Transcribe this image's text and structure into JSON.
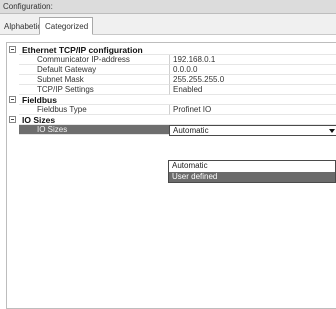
{
  "window": {
    "title": "Configuration:"
  },
  "tabs": [
    {
      "label": "Alphabetic",
      "active": false
    },
    {
      "label": "Categorized",
      "active": true
    }
  ],
  "grid": {
    "categories": [
      {
        "label": "Ethernet TCP/IP configuration"
      },
      {
        "label": "Fieldbus"
      },
      {
        "label": "IO Sizes"
      }
    ],
    "properties": [
      {
        "name": "Communicator IP-address",
        "value": "192.168.0.1"
      },
      {
        "name": "Default Gateway",
        "value": "0.0.0.0"
      },
      {
        "name": "Subnet Mask",
        "value": "255.255.255.0"
      },
      {
        "name": "TCP/IP Settings",
        "value": "Enabled"
      },
      {
        "name": "Fieldbus Type",
        "value": "Profinet IO"
      },
      {
        "name": "IO Sizes",
        "value": "Automatic",
        "selected": true
      }
    ]
  },
  "dropdown": {
    "options": [
      "Automatic",
      "User defined"
    ],
    "highlighted": "User defined"
  },
  "colors": {
    "selection": "#6e6e6e",
    "header_bg": "#dcdcdc"
  },
  "icons": {
    "expander": "collapse-minus-icon",
    "combo_arrow": "dropdown-arrow-icon"
  }
}
